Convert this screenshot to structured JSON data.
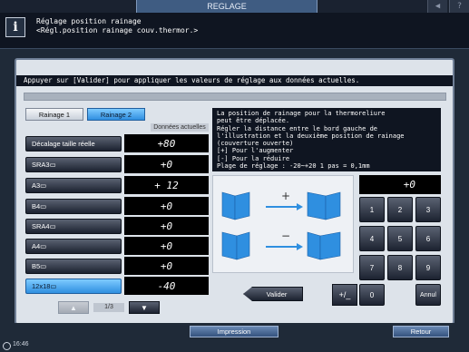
{
  "window": {
    "title": "REGLAGE"
  },
  "topbar": {
    "icons": [
      "volume-icon",
      "help-icon"
    ],
    "volume_glyph": "◀",
    "help_glyph": "?"
  },
  "header": {
    "info_glyph": "i",
    "line1": "Réglage position rainage",
    "line2": "<Régl.position rainage couv.thermor.>"
  },
  "instruction": "Appuyer sur [Valider] pour appliquer les valeurs de réglage aux données actuelles.",
  "tabs": [
    {
      "label": "Rainage 1",
      "selected": false
    },
    {
      "label": "Rainage 2",
      "selected": true
    }
  ],
  "column_header": "Données actuelles",
  "rows": [
    {
      "label": "Décalage taille réelle",
      "value": "+80",
      "selected": false
    },
    {
      "label": "SRA3▭",
      "value": "+0",
      "selected": false
    },
    {
      "label": "A3▭",
      "value": "+ 12",
      "selected": false
    },
    {
      "label": "B4▭",
      "value": "+0",
      "selected": false
    },
    {
      "label": "SRA4▭",
      "value": "+0",
      "selected": false
    },
    {
      "label": "A4▭",
      "value": "+0",
      "selected": false
    },
    {
      "label": "B5▭",
      "value": "+0",
      "selected": false
    },
    {
      "label": "12x18▭",
      "value": "-40",
      "selected": true
    }
  ],
  "pagination": {
    "up_glyph": "▲",
    "page": "1/3",
    "down_glyph": "▼"
  },
  "help_text": [
    "La position de rainage pour la thermoreliure",
    "peut être déplacée.",
    "Régler la distance entre le bord gauche de",
    "l'illustration et la deuxième position de rainage",
    "(couverture ouverte)",
    "[+] Pour l'augmenter",
    "[-] Pour la réduire",
    "Plage de réglage : -20~+20 1 pas = 0,1mm"
  ],
  "illustration": {
    "plus_symbol": "+",
    "minus_symbol": "−",
    "book_color": "#2f8fe0"
  },
  "display_value": "+0",
  "keypad": [
    "1",
    "2",
    "3",
    "4",
    "5",
    "6",
    "7",
    "8",
    "9",
    "0",
    "Annul"
  ],
  "valider_label": "Valider",
  "plusminus_label": "+/_",
  "footer": {
    "impression_label": "Impression",
    "retour_label": "Retour",
    "time": "16:46"
  },
  "colors": {
    "accent": "#2f8fe0",
    "background": "#1f2a38",
    "panel": "#dde3ea"
  }
}
